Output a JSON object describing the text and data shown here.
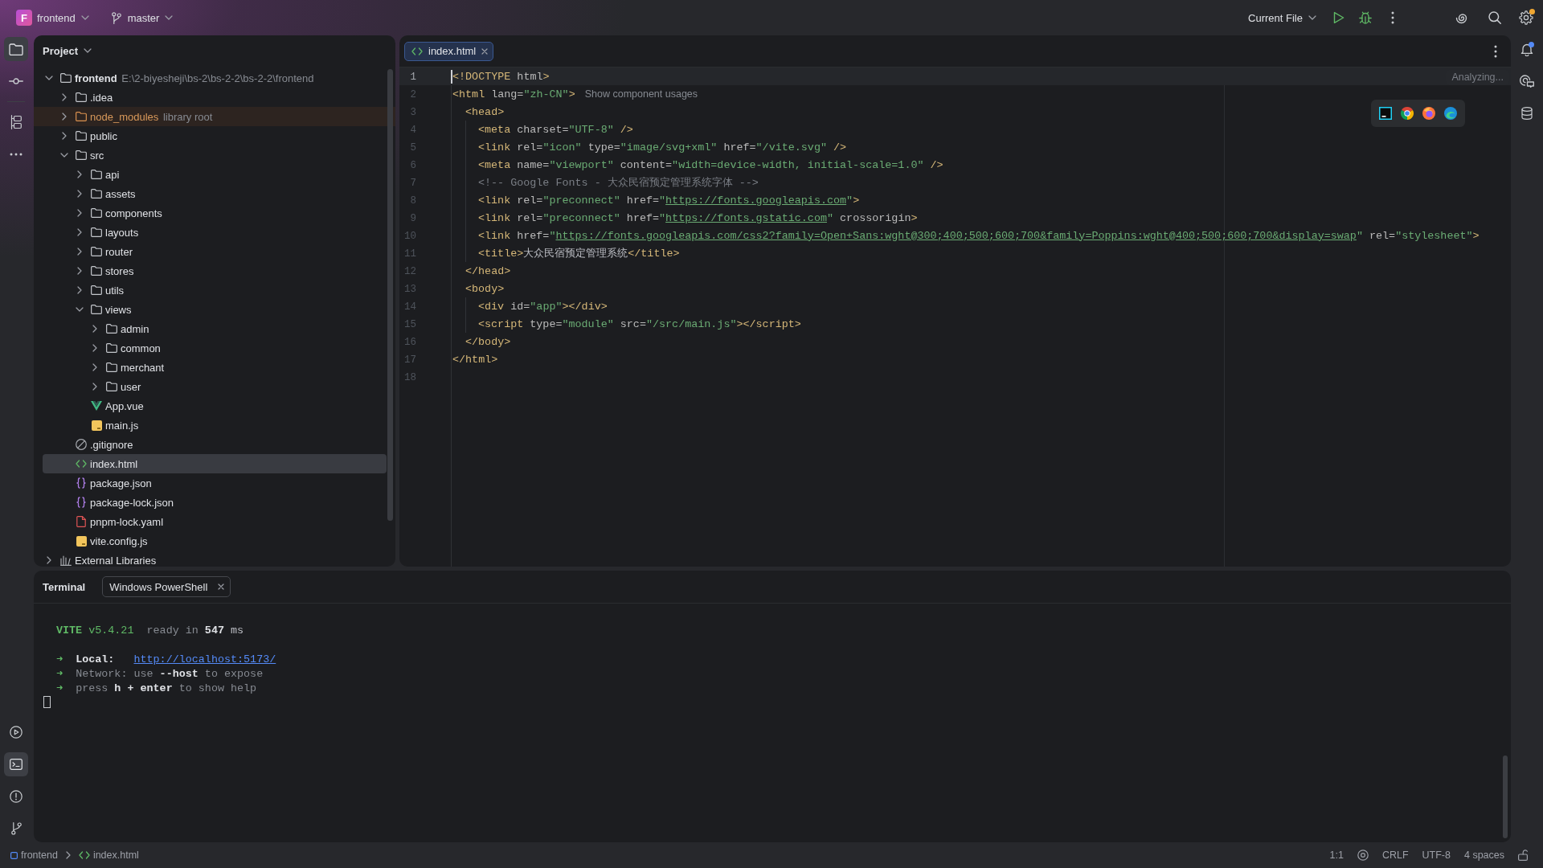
{
  "title_bar": {
    "project": {
      "badge": "F",
      "name": "frontend"
    },
    "branch": "master",
    "run_configuration": "Current File",
    "settings": {
      "badge": true
    }
  },
  "left_toolbar": {
    "top": [
      {
        "kind": "project",
        "selected": true
      },
      {
        "kind": "commit",
        "selected": false
      }
    ],
    "middle": [
      {
        "kind": "structure",
        "selected": false
      },
      {
        "kind": "more",
        "selected": false
      }
    ],
    "bottom": [
      {
        "kind": "services",
        "selected": false
      },
      {
        "kind": "terminal",
        "selected": true
      },
      {
        "kind": "problems",
        "selected": false
      },
      {
        "kind": "git",
        "selected": false
      }
    ]
  },
  "project_panel": {
    "title": "Project",
    "tree": [
      {
        "name": "frontend",
        "kind": "project",
        "hint": "E:\\2-biyesheji\\bs-2\\bs-2-2\\bs-2-2\\frontend",
        "expanded": true,
        "selected": false,
        "children": [
          {
            "name": ".idea",
            "kind": "folder",
            "expanded": false,
            "selected": false
          },
          {
            "name": "node_modules",
            "kind": "library",
            "hint": "library root",
            "expanded": false,
            "selected": false
          },
          {
            "name": "public",
            "kind": "folder",
            "expanded": false,
            "selected": false
          },
          {
            "name": "src",
            "kind": "folder",
            "expanded": true,
            "selected": false,
            "children": [
              {
                "name": "api",
                "kind": "folder",
                "expanded": false,
                "selected": false
              },
              {
                "name": "assets",
                "kind": "folder",
                "expanded": false,
                "selected": false
              },
              {
                "name": "components",
                "kind": "folder",
                "expanded": false,
                "selected": false
              },
              {
                "name": "layouts",
                "kind": "folder",
                "expanded": false,
                "selected": false
              },
              {
                "name": "router",
                "kind": "folder",
                "expanded": false,
                "selected": false
              },
              {
                "name": "stores",
                "kind": "folder",
                "expanded": false,
                "selected": false
              },
              {
                "name": "utils",
                "kind": "folder",
                "expanded": false,
                "selected": false
              },
              {
                "name": "views",
                "kind": "folder",
                "expanded": true,
                "selected": false,
                "children": [
                  {
                    "name": "admin",
                    "kind": "folder",
                    "expanded": false,
                    "selected": false
                  },
                  {
                    "name": "common",
                    "kind": "folder",
                    "expanded": false,
                    "selected": false
                  },
                  {
                    "name": "merchant",
                    "kind": "folder",
                    "expanded": false,
                    "selected": false
                  },
                  {
                    "name": "user",
                    "kind": "folder",
                    "expanded": false,
                    "selected": false
                  }
                ]
              },
              {
                "name": "App.vue",
                "kind": "vue",
                "selected": false
              },
              {
                "name": "main.js",
                "kind": "js",
                "selected": false
              }
            ]
          },
          {
            "name": ".gitignore",
            "kind": "ignore",
            "selected": false
          },
          {
            "name": "index.html",
            "kind": "html",
            "selected": true
          },
          {
            "name": "package.json",
            "kind": "json",
            "selected": false
          },
          {
            "name": "package-lock.json",
            "kind": "json",
            "selected": false
          },
          {
            "name": "pnpm-lock.yaml",
            "kind": "yaml",
            "selected": false
          },
          {
            "name": "vite.config.js",
            "kind": "js",
            "selected": false
          }
        ]
      },
      {
        "name": "External Libraries",
        "kind": "libraries",
        "expanded": false,
        "selected": false
      }
    ]
  },
  "editor": {
    "tabs": [
      {
        "label": "index.html",
        "selected": true
      }
    ],
    "status": "Analyzing...",
    "lines": [
      {
        "number": "1",
        "current": true,
        "segments": [
          {
            "kind": "tag",
            "text": "<!DOCTYPE"
          },
          {
            "kind": "attr",
            "text": " html"
          },
          {
            "kind": "tag",
            "text": ">"
          }
        ]
      },
      {
        "number": "2",
        "current": false,
        "segments": [
          {
            "kind": "tag",
            "text": "<html"
          },
          {
            "kind": "attr",
            "text": " lang="
          },
          {
            "kind": "value",
            "text": "\"zh-CN\""
          },
          {
            "kind": "tag",
            "text": ">"
          },
          {
            "kind": "inlay",
            "text": "Show component usages"
          }
        ],
        "children": [
          {
            "number": "3",
            "current": false,
            "segments": [
              {
                "kind": "tag",
                "text": "<head>"
              }
            ],
            "children": [
              {
                "number": "4",
                "current": false,
                "segments": [
                  {
                    "kind": "tag",
                    "text": "<meta"
                  },
                  {
                    "kind": "attr",
                    "text": " charset="
                  },
                  {
                    "kind": "value",
                    "text": "\"UTF-8\""
                  },
                  {
                    "kind": "tag",
                    "text": " />"
                  }
                ]
              },
              {
                "number": "5",
                "current": false,
                "segments": [
                  {
                    "kind": "tag",
                    "text": "<link"
                  },
                  {
                    "kind": "attr",
                    "text": " rel="
                  },
                  {
                    "kind": "value",
                    "text": "\"icon\""
                  },
                  {
                    "kind": "attr",
                    "text": " type="
                  },
                  {
                    "kind": "value",
                    "text": "\"image/svg+xml\""
                  },
                  {
                    "kind": "attr",
                    "text": " href="
                  },
                  {
                    "kind": "value",
                    "text": "\"/vite.svg\""
                  },
                  {
                    "kind": "tag",
                    "text": " />"
                  }
                ]
              },
              {
                "number": "6",
                "current": false,
                "segments": [
                  {
                    "kind": "tag",
                    "text": "<meta"
                  },
                  {
                    "kind": "attr",
                    "text": " name="
                  },
                  {
                    "kind": "value",
                    "text": "\"viewport\""
                  },
                  {
                    "kind": "attr",
                    "text": " content="
                  },
                  {
                    "kind": "value",
                    "text": "\"width=device-width, initial-scale=1.0\""
                  },
                  {
                    "kind": "tag",
                    "text": " />"
                  }
                ]
              },
              {
                "number": "7",
                "current": false,
                "segments": [
                  {
                    "kind": "comment",
                    "text": "<!-- Google Fonts - 大众民宿预定管理系统字体 -->"
                  }
                ]
              },
              {
                "number": "8",
                "current": false,
                "segments": [
                  {
                    "kind": "tag",
                    "text": "<link"
                  },
                  {
                    "kind": "attr",
                    "text": " rel="
                  },
                  {
                    "kind": "value",
                    "text": "\"preconnect\""
                  },
                  {
                    "kind": "attr",
                    "text": " href="
                  },
                  {
                    "kind": "value",
                    "text": "\""
                  },
                  {
                    "kind": "link",
                    "text": "https://fonts.googleapis.com"
                  },
                  {
                    "kind": "value",
                    "text": "\""
                  },
                  {
                    "kind": "tag",
                    "text": ">"
                  }
                ]
              },
              {
                "number": "9",
                "current": false,
                "segments": [
                  {
                    "kind": "tag",
                    "text": "<link"
                  },
                  {
                    "kind": "attr",
                    "text": " rel="
                  },
                  {
                    "kind": "value",
                    "text": "\"preconnect\""
                  },
                  {
                    "kind": "attr",
                    "text": " href="
                  },
                  {
                    "kind": "value",
                    "text": "\""
                  },
                  {
                    "kind": "link",
                    "text": "https://fonts.gstatic.com"
                  },
                  {
                    "kind": "value",
                    "text": "\""
                  },
                  {
                    "kind": "attr",
                    "text": " crossorigin"
                  },
                  {
                    "kind": "tag",
                    "text": ">"
                  }
                ]
              },
              {
                "number": "10",
                "current": false,
                "segments": [
                  {
                    "kind": "tag",
                    "text": "<link"
                  },
                  {
                    "kind": "attr",
                    "text": " href="
                  },
                  {
                    "kind": "value",
                    "text": "\""
                  },
                  {
                    "kind": "link",
                    "text": "https://fonts.googleapis.com/css2?family=Open+Sans:wght@300;400;500;600;700&family=Poppins:wght@400;500;600;700&display=swap"
                  },
                  {
                    "kind": "value",
                    "text": "\""
                  },
                  {
                    "kind": "attr",
                    "text": " rel="
                  },
                  {
                    "kind": "value",
                    "text": "\"stylesheet\""
                  },
                  {
                    "kind": "tag",
                    "text": ">"
                  }
                ]
              },
              {
                "number": "11",
                "current": false,
                "segments": [
                  {
                    "kind": "tag",
                    "text": "<title>"
                  },
                  {
                    "kind": "text",
                    "text": "大众民宿预定管理系统"
                  },
                  {
                    "kind": "tag",
                    "text": "</title>"
                  }
                ]
              }
            ]
          },
          {
            "number": "12",
            "current": false,
            "segments": [
              {
                "kind": "tag",
                "text": "</head>"
              }
            ]
          },
          {
            "number": "13",
            "current": false,
            "segments": [
              {
                "kind": "tag",
                "text": "<body>"
              }
            ],
            "children": [
              {
                "number": "14",
                "current": false,
                "segments": [
                  {
                    "kind": "tag",
                    "text": "<div"
                  },
                  {
                    "kind": "attr",
                    "text": " id="
                  },
                  {
                    "kind": "value",
                    "text": "\"app\""
                  },
                  {
                    "kind": "tag",
                    "text": "></div>"
                  }
                ]
              },
              {
                "number": "15",
                "current": false,
                "segments": [
                  {
                    "kind": "tag",
                    "text": "<script"
                  },
                  {
                    "kind": "attr",
                    "text": " type="
                  },
                  {
                    "kind": "value",
                    "text": "\"module\""
                  },
                  {
                    "kind": "attr",
                    "text": " src="
                  },
                  {
                    "kind": "value",
                    "text": "\"/src/main.js\""
                  },
                  {
                    "kind": "tag",
                    "text": "></script>"
                  }
                ]
              }
            ]
          },
          {
            "number": "16",
            "current": false,
            "segments": [
              {
                "kind": "tag",
                "text": "</body>"
              }
            ]
          }
        ]
      },
      {
        "number": "17",
        "current": false,
        "segments": [
          {
            "kind": "tag",
            "text": "</html>"
          }
        ]
      },
      {
        "number": "18",
        "current": false
      }
    ]
  },
  "right_toolbar": {
    "notifications": {
      "badge": true
    }
  },
  "terminal": {
    "title": "Terminal",
    "tabs": [
      {
        "label": "Windows PowerShell",
        "selected": true
      }
    ],
    "lines": [
      {
        "kind": "output",
        "segments": [
          {
            "kind": "accent_bold",
            "text": "VITE"
          },
          {
            "kind": "accent",
            "text": " v5.4.21"
          },
          {
            "kind": "dim",
            "text": "  ready in "
          },
          {
            "kind": "strong",
            "text": "547"
          },
          {
            "kind": "plain",
            "text": " ms"
          }
        ]
      },
      {
        "kind": "blank"
      },
      {
        "kind": "output",
        "segments": [
          {
            "kind": "accent",
            "text": "➜  "
          },
          {
            "kind": "strong",
            "text": "Local:   "
          },
          {
            "kind": "link",
            "text": "http://localhost:5173/"
          }
        ]
      },
      {
        "kind": "output",
        "segments": [
          {
            "kind": "accent",
            "text": "➜  "
          },
          {
            "kind": "dim",
            "text": "Network: use "
          },
          {
            "kind": "strong",
            "text": "--host"
          },
          {
            "kind": "dim",
            "text": " to expose"
          }
        ]
      },
      {
        "kind": "output",
        "segments": [
          {
            "kind": "accent",
            "text": "➜  "
          },
          {
            "kind": "dim",
            "text": "press "
          },
          {
            "kind": "strong",
            "text": "h + enter"
          },
          {
            "kind": "dim",
            "text": " to show help"
          }
        ]
      }
    ]
  },
  "status_bar": {
    "breadcrumbs": [
      {
        "kind": "module",
        "label": "frontend"
      },
      {
        "kind": "html",
        "label": "index.html"
      }
    ],
    "position": "1:1",
    "line_separator": "CRLF",
    "encoding": "UTF-8",
    "indent": "4 spaces"
  }
}
